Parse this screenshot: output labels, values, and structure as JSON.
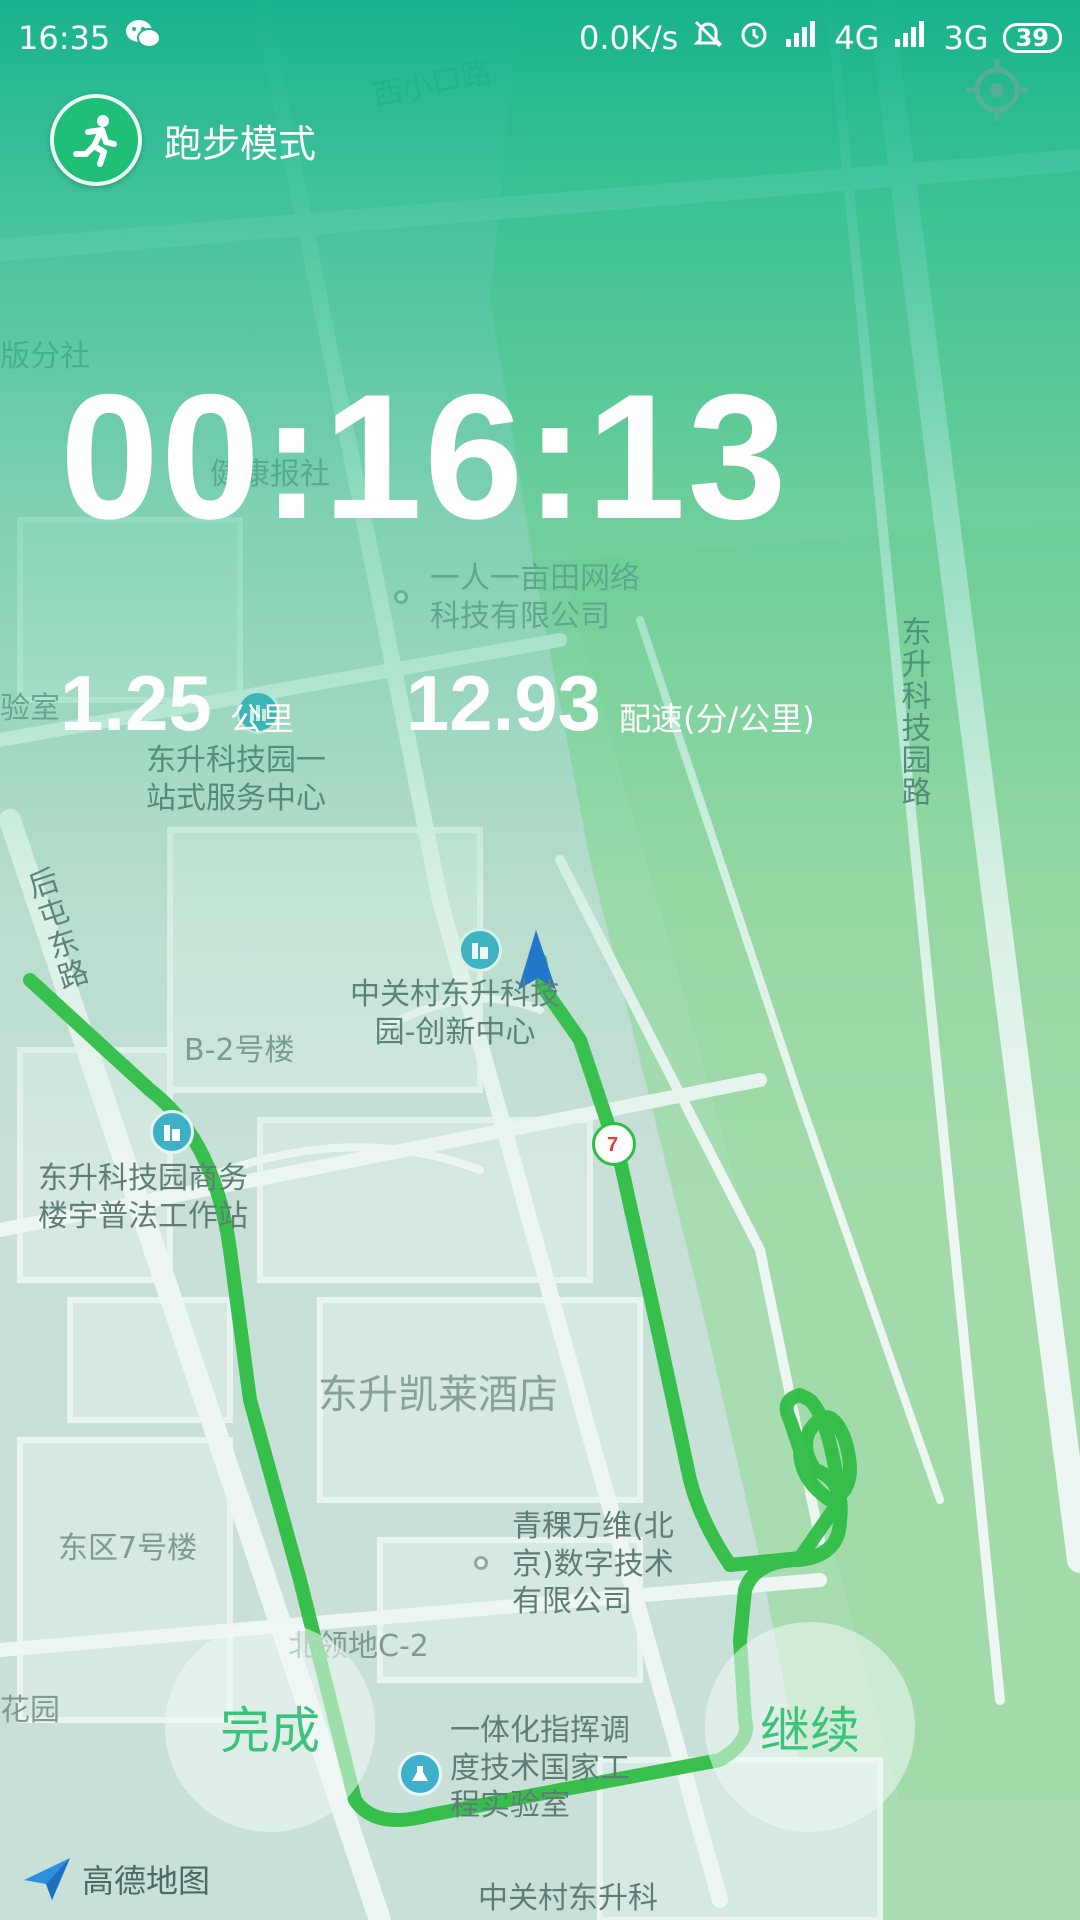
{
  "status_bar": {
    "time": "16:35",
    "network_speed": "0.0K/s",
    "signal_1": "4G",
    "signal_2": "3G",
    "battery": "39",
    "icons": [
      "wechat-icon",
      "mute-icon",
      "alarm-icon",
      "hd-icon",
      "signal-icon",
      "signal-icon"
    ]
  },
  "header": {
    "mode_title": "跑步模式",
    "mode_icon": "running-person-icon",
    "locate_icon": "locate-icon"
  },
  "timer": {
    "elapsed": "00:16:13"
  },
  "stats": {
    "distance_value": "1.25",
    "distance_unit": "公里",
    "pace_value": "12.93",
    "pace_unit": "配速(分/公里)"
  },
  "buttons": {
    "finish": "完成",
    "continue": "继续"
  },
  "map": {
    "labels": {
      "road_xixiaokou": "西小口路",
      "publisher": "版分社",
      "jiankang_baoshe": "健康报社",
      "yirenyimu": "一人一亩田网络\n科技有限公司",
      "lab_room": "验室",
      "dongsheng_service": "东升科技园一\n站式服务中心",
      "road_houtun": "后屯东路",
      "zgc_innovation": "中关村东升科技\n园-创新中心",
      "b2": "B-2号楼",
      "dongsheng_law": "东升科技园商务\n楼宇普法工作站",
      "kailai": "东升凯莱酒店",
      "qingke": "青稞万维(北\n京)数字技术\n有限公司",
      "east7": "东区7号楼",
      "beiling": "北领地C-2",
      "flower_garden": "花园",
      "command_lab": "一体化指挥调\n度技术国家工\n程实验室",
      "zgc_bottom": "中关村东升科",
      "road_dongsheng": "东升科技园路"
    },
    "provider": "高德地图",
    "route_color": "#2fbd44"
  }
}
